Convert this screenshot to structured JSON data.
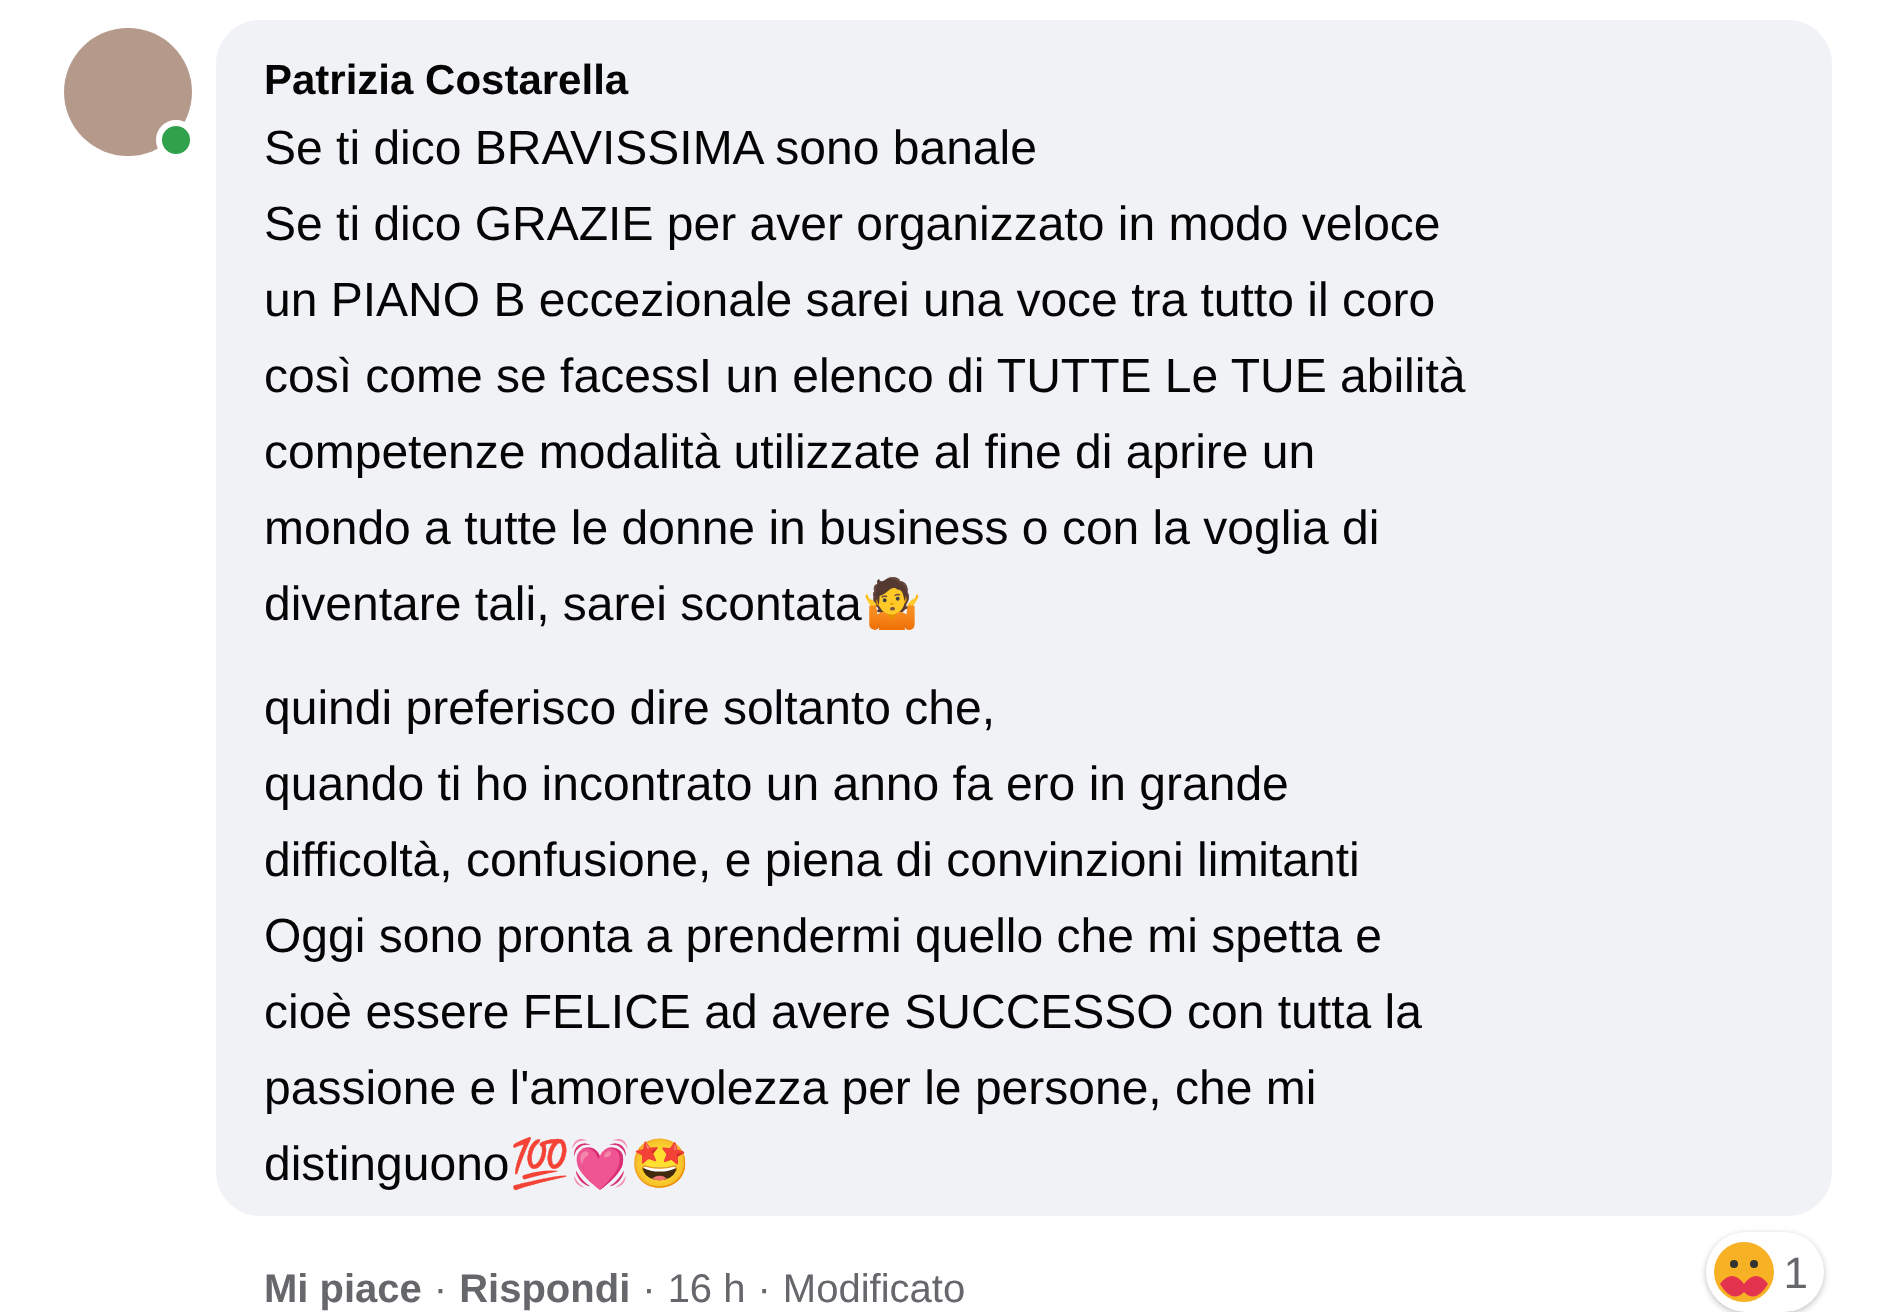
{
  "comment": {
    "author": "Patrizia Costarella",
    "online": true,
    "paragraphs": [
      [
        "Se ti dico BRAVISSIMA sono banale",
        "Se ti dico GRAZIE per aver organizzato in modo veloce",
        "un PIANO B eccezionale sarei una voce tra tutto il coro",
        "così come se facessI un elenco di TUTTE Le TUE abilità",
        "competenze modalità utilizzate al fine di aprire un",
        "mondo a tutte le donne in business o con la voglia di",
        "diventare tali, sarei scontata🤷"
      ],
      [
        "quindi preferisco dire soltanto che,",
        "quando ti ho incontrato un anno fa ero in grande",
        "difficoltà, confusione, e piena di convinzioni limitanti",
        "Oggi sono pronta a prendermi quello che mi spetta e",
        "cioè essere FELICE ad avere SUCCESSO con tutta la",
        "passione e l'amorevolezza per le persone, che mi",
        "distinguono💯💓🤩"
      ]
    ],
    "reaction_count": "1",
    "actions": [
      {
        "kind": "link",
        "text": "Mi piace"
      },
      {
        "kind": "link",
        "text": "Rispondi"
      },
      {
        "kind": "meta",
        "text": "16 h"
      },
      {
        "kind": "meta",
        "text": "Modificato"
      }
    ],
    "separator": "·"
  }
}
